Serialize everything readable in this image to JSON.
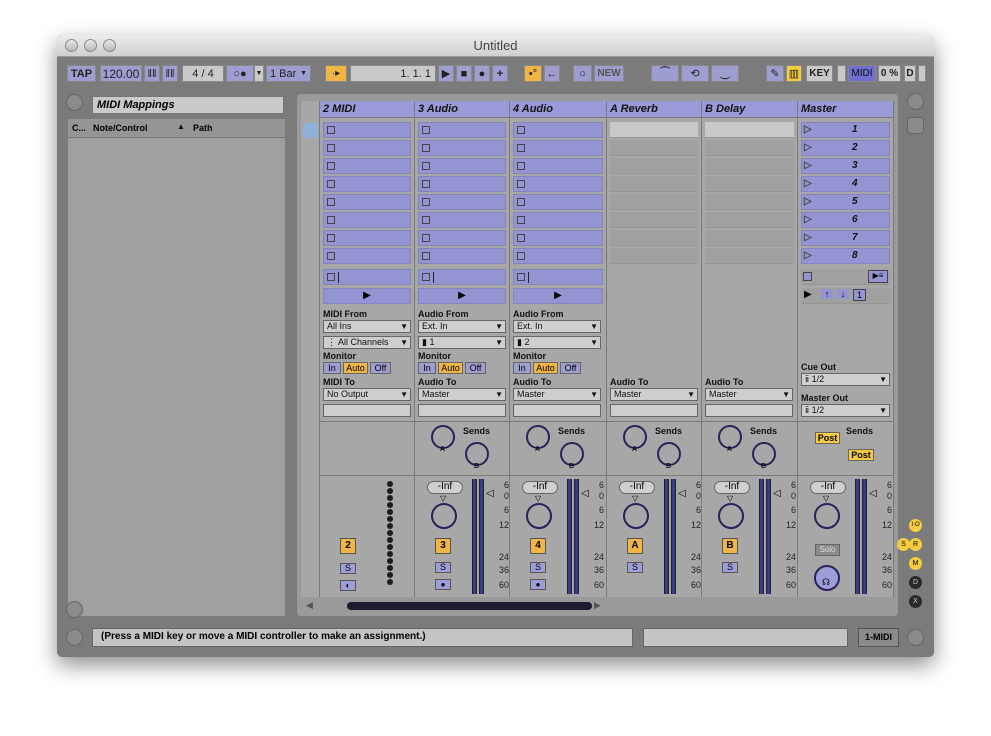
{
  "window": {
    "title": "Untitled"
  },
  "transport": {
    "tap": "TAP",
    "tempo": "120.00",
    "signature_num": "4",
    "signature_sep": "/",
    "signature_den": "4",
    "quantize": "1 Bar",
    "position": "1.  1.  1",
    "new": "NEW",
    "key": "KEY",
    "midi": "MIDI",
    "cpu": "0 %",
    "disk": "D"
  },
  "browser": {
    "title": "MIDI Mappings",
    "col_c": "C...",
    "col_note": "Note/Control",
    "col_path": "Path"
  },
  "tracks": [
    {
      "name": "2 MIDI",
      "in_label": "MIDI From",
      "in_val": "All Ins",
      "ch_val": "All Channels",
      "out_label": "MIDI To",
      "out_val": "No Output",
      "num": "2"
    },
    {
      "name": "3 Audio",
      "in_label": "Audio From",
      "in_val": "Ext. In",
      "ch_val": "1",
      "out_label": "Audio To",
      "out_val": "Master",
      "num": "3"
    },
    {
      "name": "4 Audio",
      "in_label": "Audio From",
      "in_val": "Ext. In",
      "ch_val": "2",
      "out_label": "Audio To",
      "out_val": "Master",
      "num": "4"
    },
    {
      "name": "A Reverb",
      "out_label": "Audio To",
      "out_val": "Master",
      "num": "A"
    },
    {
      "name": "B Delay",
      "out_label": "Audio To",
      "out_val": "Master",
      "num": "B"
    },
    {
      "name": "Master",
      "num": ""
    }
  ],
  "monitor": {
    "label": "Monitor",
    "in": "In",
    "auto": "Auto",
    "off": "Off"
  },
  "master": {
    "scenes": [
      "1",
      "2",
      "3",
      "4",
      "5",
      "6",
      "7",
      "8"
    ],
    "cue_label": "Cue Out",
    "cue_val": "1/2",
    "master_label": "Master Out",
    "master_val": "1/2",
    "post1": "Post",
    "post2": "Post",
    "solo": "Solo",
    "scene_num": "1"
  },
  "mixer": {
    "sends": "Sends",
    "inf": "-Inf",
    "s": "S",
    "a": "A",
    "b": "B",
    "scale": [
      "6",
      "0",
      "6",
      "12",
      "24",
      "36",
      "60"
    ]
  },
  "status": {
    "text": "(Press a MIDI key or move a MIDI controller to make an assignment.)",
    "midi_out": "1-MIDI"
  }
}
